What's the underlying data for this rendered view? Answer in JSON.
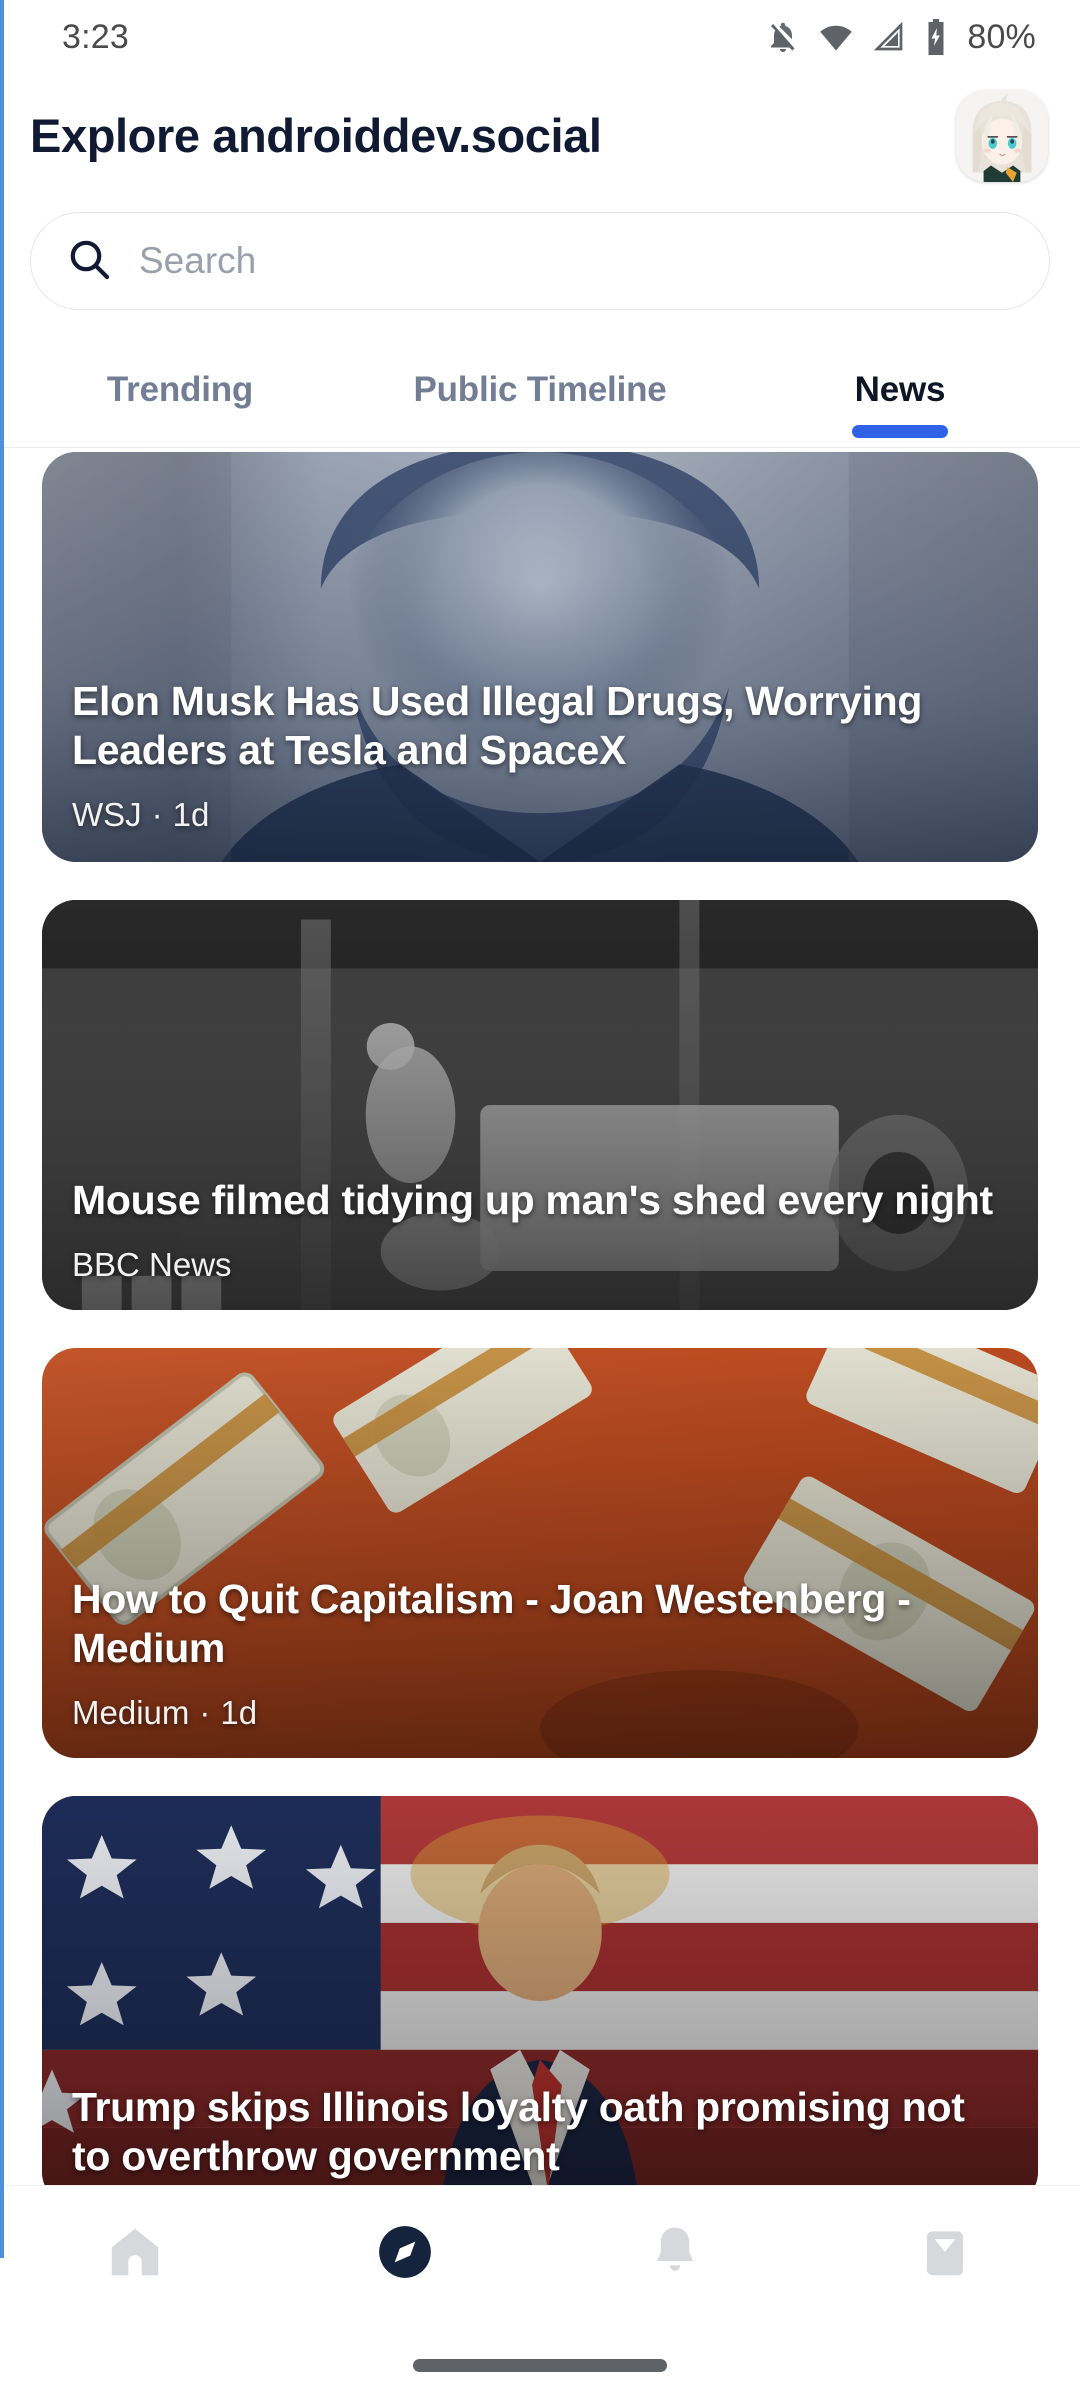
{
  "status_bar": {
    "time": "3:23",
    "battery_percent": "80%",
    "icons": [
      "notifications-off-icon",
      "wifi-icon",
      "cell-signal-icon",
      "battery-charging-icon"
    ]
  },
  "header": {
    "title": "Explore androiddev.social",
    "avatar_name": "user-avatar"
  },
  "search": {
    "placeholder": "Search",
    "value": "",
    "icon": "search-icon"
  },
  "tabs": [
    {
      "label": "Trending",
      "active": false
    },
    {
      "label": "Public Timeline",
      "active": false
    },
    {
      "label": "News",
      "active": true
    }
  ],
  "feed": {
    "cards": [
      {
        "headline": "Elon Musk Has Used Illegal Drugs, Worrying Leaders at Tesla and SpaceX",
        "source": "WSJ",
        "separator": "·",
        "time": "1d",
        "image_alt": "portrait-photo-blue-duotone"
      },
      {
        "headline": "Mouse filmed tidying up man's shed every night",
        "source": "BBC News",
        "separator": "",
        "time": "",
        "image_alt": "greyscale-shed-night-vision-photo"
      },
      {
        "headline": "How to Quit Capitalism - Joan Westenberg - Medium",
        "source": "Medium",
        "separator": "·",
        "time": "1d",
        "image_alt": "dollar-bills-on-orange-background"
      },
      {
        "headline": "Trump skips Illinois loyalty oath promising not to overthrow government",
        "source": "",
        "separator": "",
        "time": "",
        "image_alt": "man-in-front-of-american-flag"
      }
    ]
  },
  "bottom_nav": [
    {
      "name": "home",
      "icon": "home-icon",
      "active": false
    },
    {
      "name": "explore",
      "icon": "compass-icon",
      "active": true
    },
    {
      "name": "notifications",
      "icon": "bell-icon",
      "active": false
    },
    {
      "name": "messages",
      "icon": "inbox-icon",
      "active": false
    }
  ],
  "colors": {
    "accent_blue": "#3062e8",
    "title_navy": "#101a33",
    "nav_active": "#16233c",
    "nav_inactive": "#d6d8dc",
    "tab_inactive": "#737e94",
    "placeholder_grey": "#9aa0ab"
  }
}
